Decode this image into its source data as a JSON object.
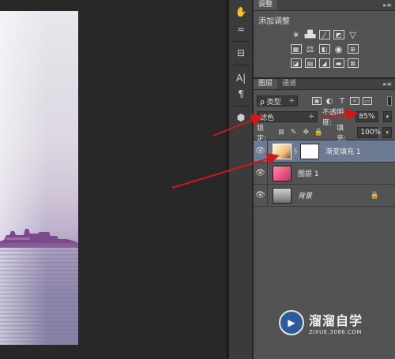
{
  "adjustments_panel": {
    "tab_label": "调整",
    "subtitle": "添加调整",
    "row1_icons": [
      "brightness-icon",
      "levels-icon",
      "curves-icon",
      "exposure-icon",
      "triangle-icon"
    ],
    "row2_icons": [
      "vibrance-icon",
      "balance-icon",
      "bw-icon",
      "camera-icon",
      "grid-icon"
    ],
    "row3_icons": [
      "invert-icon",
      "posterize-icon",
      "threshold-icon",
      "gradient-map-icon",
      "selective-color-icon"
    ]
  },
  "layers_panel": {
    "tabs": [
      "图层",
      "通道"
    ],
    "kind_label": "ρ 类型",
    "blend_mode": "滤色",
    "opacity_label": "不透明度:",
    "opacity_value": "85%",
    "lock_label": "锁定:",
    "fill_label": "填充:",
    "fill_value": "100%",
    "layers": [
      {
        "name": "渐变填充 1",
        "selected": true
      },
      {
        "name": "图层 1",
        "selected": false
      },
      {
        "name": "背景",
        "selected": false
      }
    ]
  },
  "watermark": {
    "title": "溜溜自学",
    "url": "ZIXUE.3066.COM"
  },
  "colors": {
    "selected_row": "#6c7b93",
    "arrow": "#d01818"
  }
}
